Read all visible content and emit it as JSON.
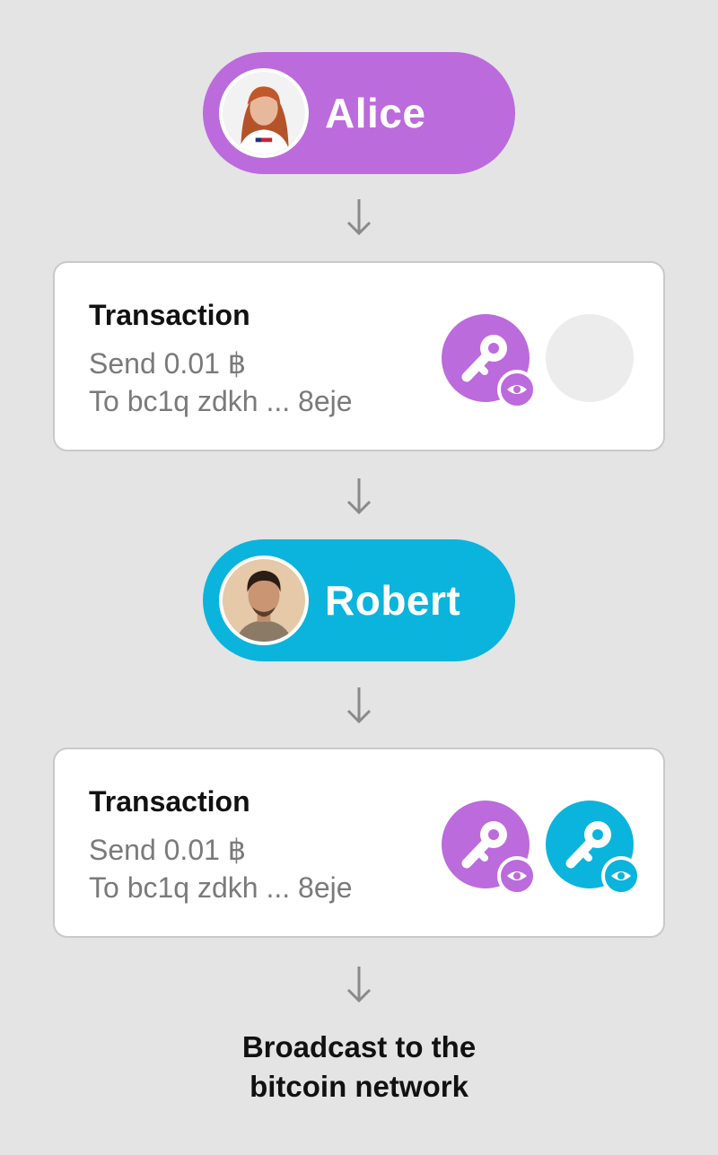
{
  "colors": {
    "background": "#e4e4e4",
    "alice": "#bb6bdc",
    "robert": "#0bb4dc",
    "card": "#ffffff",
    "empty_slot": "#ececec"
  },
  "participants": [
    {
      "name": "Alice",
      "avatar": "alice-avatar"
    },
    {
      "name": "Robert",
      "avatar": "robert-avatar"
    }
  ],
  "transactions": [
    {
      "title": "Transaction",
      "amount": "Send 0.01 ฿",
      "recipient": "To bc1q zdkh ... 8eje",
      "signatures": [
        "alice-key-icon",
        "empty-signature-slot"
      ]
    },
    {
      "title": "Transaction",
      "amount": "Send 0.01 ฿",
      "recipient": "To bc1q zdkh ... 8eje",
      "signatures": [
        "alice-key-icon",
        "robert-key-icon"
      ]
    }
  ],
  "footer": {
    "line1": "Broadcast to the",
    "line2": "bitcoin network"
  }
}
